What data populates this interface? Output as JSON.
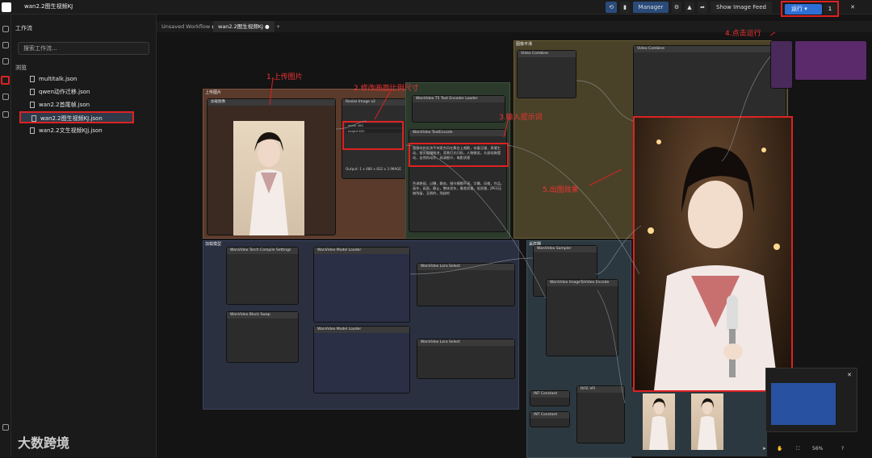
{
  "app": {
    "tab": "wan2.2图生视频KJ"
  },
  "topbar": {
    "manager": "Manager",
    "show_image_feed": "Show Image Feed",
    "run": "运行",
    "run_count": "1"
  },
  "panel": {
    "title": "工作流",
    "search_placeholder": "搜索工作流...",
    "section": "浏览",
    "files": [
      "multitalk.json",
      "qwen动作迁移.json",
      "wan2.2首尾帧.json",
      "wan2.2图生视频KJ.json",
      "wan2.2文生视频KJj.json"
    ]
  },
  "tabs": [
    "Unsaved Workflow",
    "wan2.2图生视频KJ"
  ],
  "annotations": {
    "a1": "1.上传图片",
    "a2": "2.修改画面比例尺寸",
    "a3": "3.输入提示词",
    "a4": "4.点击运行",
    "a5": "5.出图效果"
  },
  "groups": {
    "g1": "上传图片",
    "g2": "加载模型",
    "g3": "图像平滑",
    "g4": "采样器"
  },
  "nodes": {
    "load_image": "加载图像",
    "resize": "Resize Image v2",
    "t5": "WanVideo T5 Text Encoder Loader",
    "textenc": "WanVideo TextEncode",
    "vae": "Video Combine",
    "model_loader": "WanVideo Model Loader",
    "torch": "WanVideo Torch Compile Settings",
    "block_swap": "WanVideo Block Swap",
    "lora": "WanVideo Lora Select",
    "sampler": "WanVideo Sampler",
    "decode": "WanVideo Decode",
    "imgtovid": "WanVideo ImageToVideo Encode",
    "rife": "RIFE VFI",
    "int": "INT Constant",
    "output": "Output: 1 x 480 x 832 x 3 IMAGE"
  },
  "prompt_text": "画面中的女孩手持麦克风在舞台上唱歌，穿着汉服，表情生动，镜头缓慢推进，背景灯光闪烁，人物微笑，头部轻微摆动，自然的动作，高清细节，电影质感",
  "neg_text": "色调艳丽，过曝，静态，细节模糊不清，字幕，风格，作品，画作，画面，静止，整体发灰，最差质量，低质量，JPEG压缩残留，丑陋的，残缺的",
  "footer": {
    "zoom": "56%",
    "brand": "大数跨境"
  },
  "sizes": {
    "width": "480",
    "height": "832"
  }
}
